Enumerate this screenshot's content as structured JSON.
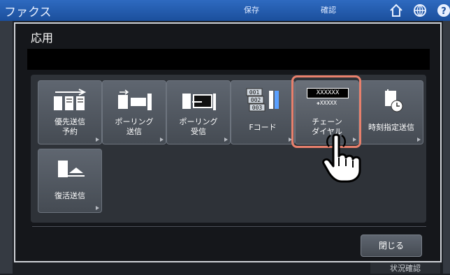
{
  "app": {
    "title": "ファクス"
  },
  "top": {
    "save": "保存",
    "confirm": "確認"
  },
  "dialog": {
    "title": "応用",
    "message": ""
  },
  "tiles": [
    {
      "label": "優先送信\n予約"
    },
    {
      "label": "ポーリング\n送信"
    },
    {
      "label": "ポーリング\n受信"
    },
    {
      "label": "Fコード"
    },
    {
      "label": "チェーン\nダイヤル",
      "icon_text": "XXXXXX",
      "icon_sub": "XXXXX"
    },
    {
      "label": "時刻指定送信"
    },
    {
      "label": "復活送信"
    }
  ],
  "fcode_icon": [
    "001",
    "002",
    "003"
  ],
  "close": "閉じる",
  "status": "状況確認",
  "colors": {
    "highlight": "#e8806c",
    "topbar": "#2e6ac0"
  },
  "icons": [
    "home-icon",
    "globe-icon",
    "help-icon",
    "pointing-hand-icon"
  ]
}
